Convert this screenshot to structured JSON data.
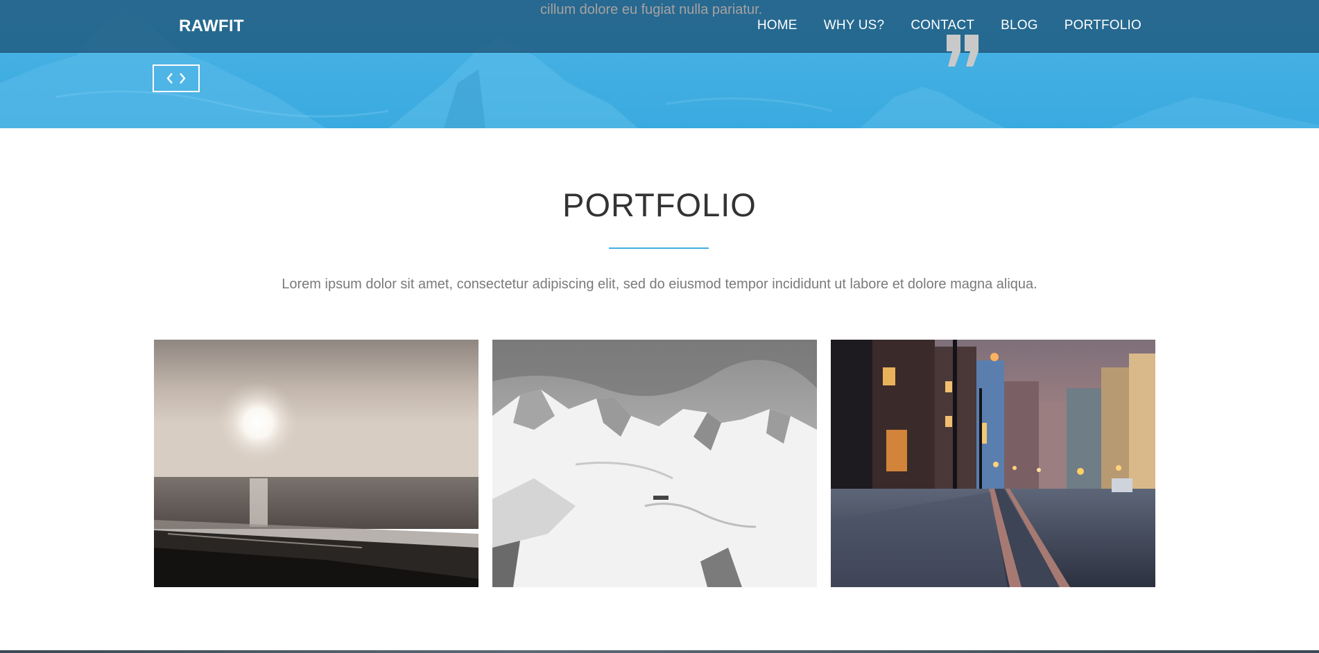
{
  "navbar": {
    "brand": "RAWFIT",
    "links": [
      {
        "label": "HOME"
      },
      {
        "label": "WHY US?"
      },
      {
        "label": "CONTACT"
      },
      {
        "label": "BLOG"
      },
      {
        "label": "PORTFOLIO"
      }
    ]
  },
  "hero": {
    "quote_text": "cillum dolore eu fugiat nulla pariatur.",
    "quote_icon": "quote-mark-icon",
    "slider_prev_icon": "chevron-left-icon",
    "slider_next_icon": "chevron-right-icon"
  },
  "portfolio": {
    "title": "PORTFOLIO",
    "subtitle": "Lorem ipsum dolor sit amet, consectetur adipiscing elit, sed do eiusmod tempor incididunt ut labore et dolore magna aliqua.",
    "items": [
      {
        "image": "sunset-beach-photo"
      },
      {
        "image": "snowy-mountains-photo"
      },
      {
        "image": "city-street-night-photo"
      }
    ]
  },
  "colors": {
    "accent": "#3daee2",
    "navbar_bg": "#1e5578",
    "title_text": "#333333",
    "body_text": "#7a7a7a"
  }
}
